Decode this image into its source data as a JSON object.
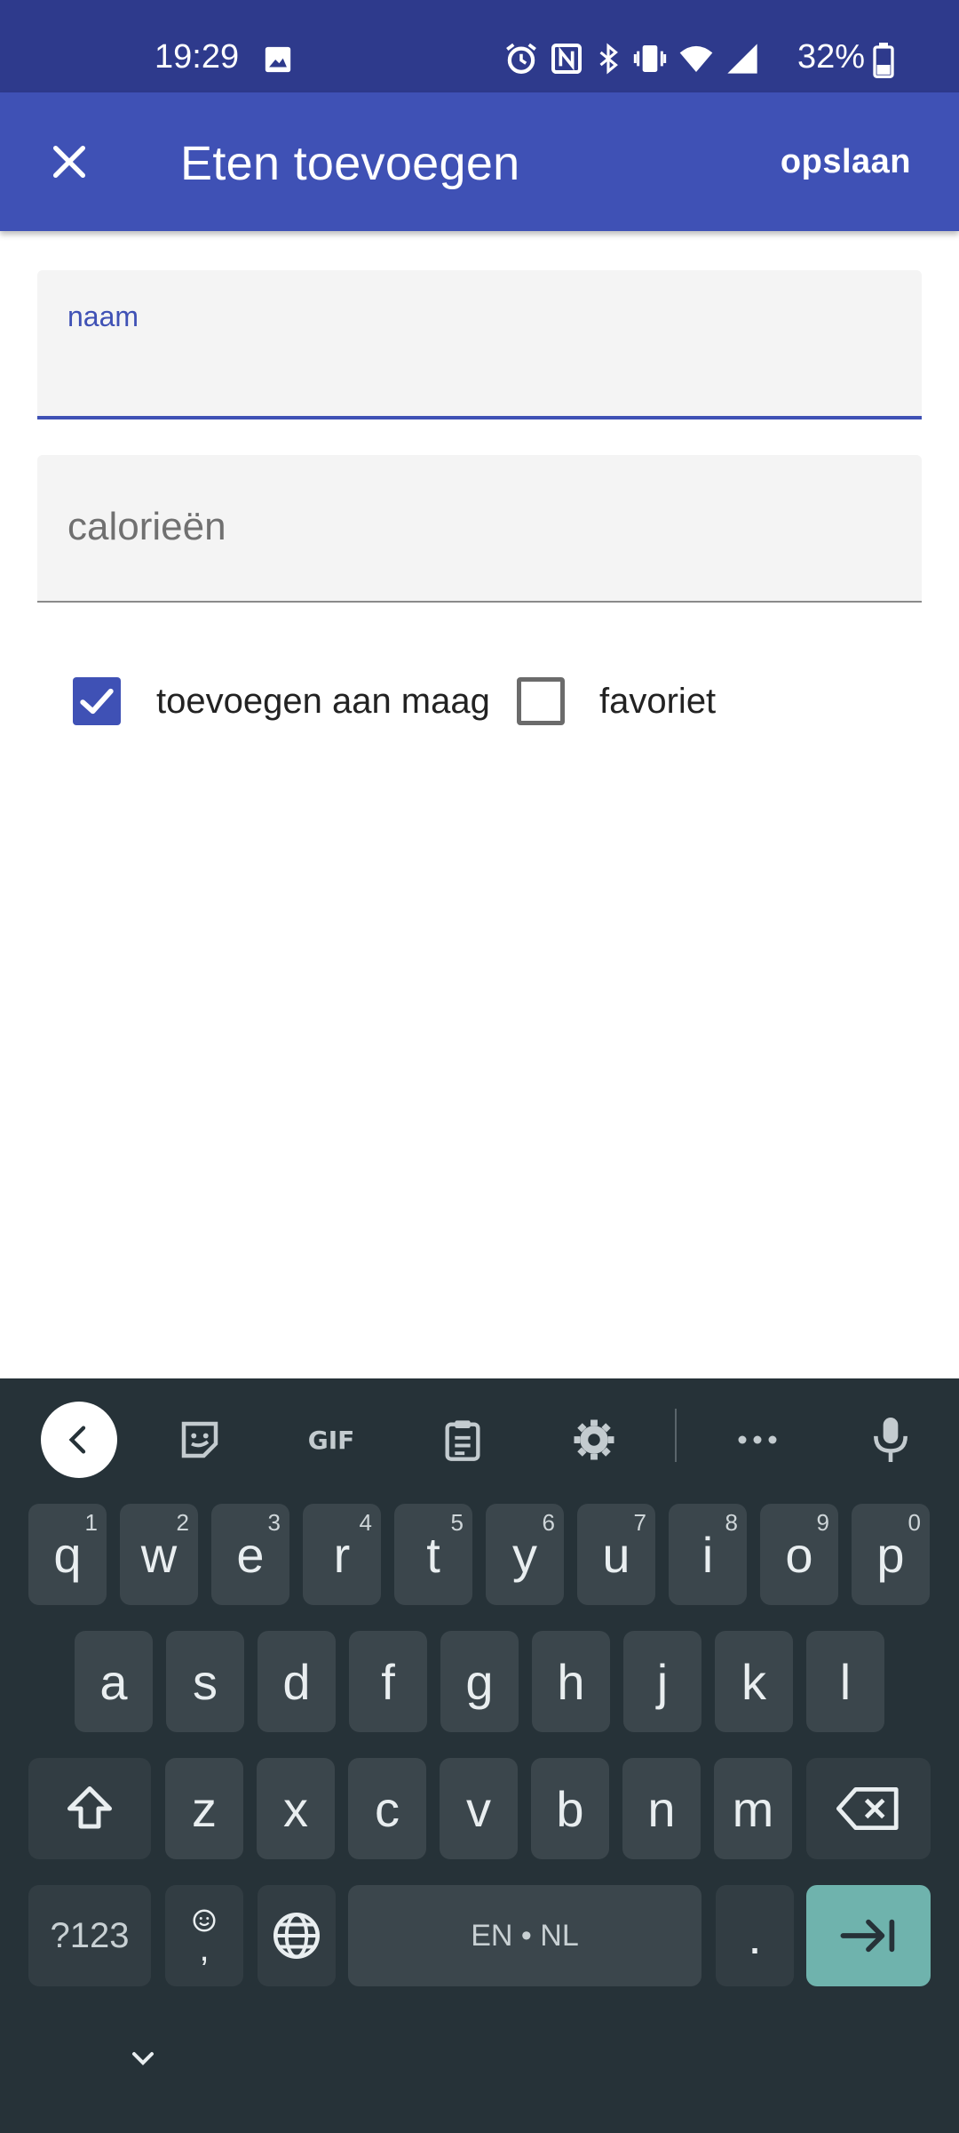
{
  "status_bar": {
    "time": "19:29",
    "battery_percent": "32%"
  },
  "app_bar": {
    "title": "Eten toevoegen",
    "save_label": "opslaan"
  },
  "form": {
    "name_field": {
      "label": "naam",
      "value": ""
    },
    "calories_field": {
      "placeholder": "calorieën",
      "value": ""
    }
  },
  "options": {
    "add_to_stomach": {
      "label": "toevoegen aan maag",
      "checked": true
    },
    "favorite": {
      "label": "favoriet",
      "checked": false
    }
  },
  "keyboard": {
    "row1": [
      {
        "k": "q",
        "h": "1"
      },
      {
        "k": "w",
        "h": "2"
      },
      {
        "k": "e",
        "h": "3"
      },
      {
        "k": "r",
        "h": "4"
      },
      {
        "k": "t",
        "h": "5"
      },
      {
        "k": "y",
        "h": "6"
      },
      {
        "k": "u",
        "h": "7"
      },
      {
        "k": "i",
        "h": "8"
      },
      {
        "k": "o",
        "h": "9"
      },
      {
        "k": "p",
        "h": "0"
      }
    ],
    "row2": [
      "a",
      "s",
      "d",
      "f",
      "g",
      "h",
      "j",
      "k",
      "l"
    ],
    "row3": [
      "z",
      "x",
      "c",
      "v",
      "b",
      "n",
      "m"
    ],
    "symbols_label": "?123",
    "emoji_comma": ",",
    "space_label": "EN • NL",
    "period": "."
  },
  "colors": {
    "primary": "#3f51b5",
    "status_bar": "#2e3a8c",
    "keyboard_bg": "#263238",
    "enter_key": "#6fb3ad"
  }
}
